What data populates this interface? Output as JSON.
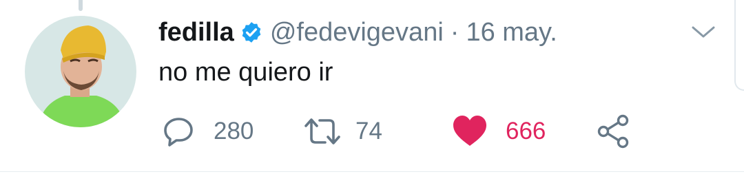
{
  "tweet": {
    "display_name": "fedilla",
    "handle": "@fedevigevani",
    "separator": "·",
    "date": "16 may.",
    "text": "no me quiero ir",
    "verified": true
  },
  "actions": {
    "reply_count": "280",
    "retweet_count": "74",
    "like_count": "666"
  },
  "icons": {
    "reply": "reply-icon",
    "retweet": "retweet-icon",
    "like": "heart-icon",
    "share": "share-icon",
    "menu": "chevron-down-icon",
    "verified": "verified-badge-icon"
  },
  "colors": {
    "text_primary": "#14171a",
    "text_secondary": "#657786",
    "verified_blue": "#1da1f2",
    "like_red": "#e0245e",
    "avatar_shirt_green": "#7ed957",
    "avatar_hat_yellow": "#e8b931",
    "avatar_bg": "#d7e7e6"
  }
}
